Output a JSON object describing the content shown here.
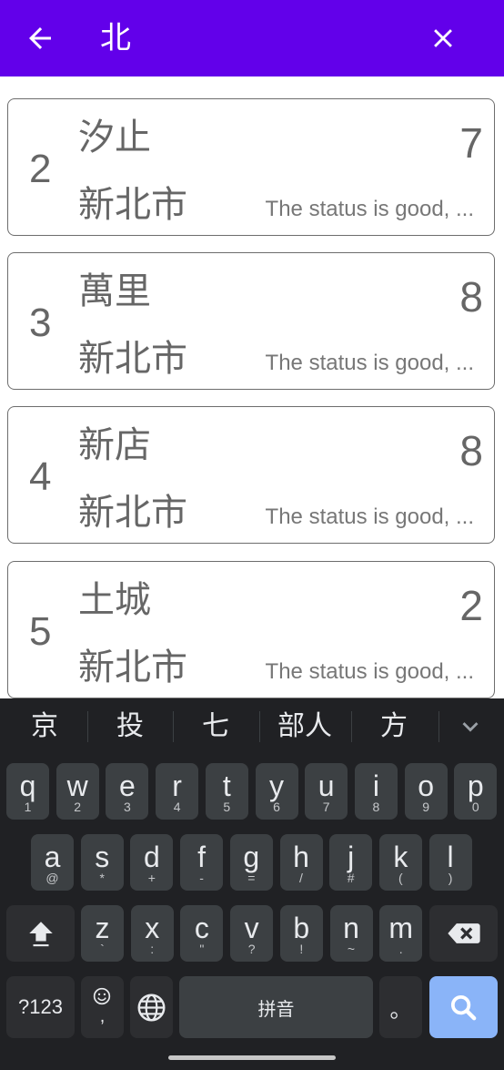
{
  "search": {
    "query": "北"
  },
  "results": [
    {
      "rank": "2",
      "name": "汐止",
      "city": "新北市",
      "count": "7",
      "status": "The status is good, ..."
    },
    {
      "rank": "3",
      "name": "萬里",
      "city": "新北市",
      "count": "8",
      "status": "The status is good, ..."
    },
    {
      "rank": "4",
      "name": "新店",
      "city": "新北市",
      "count": "8",
      "status": "The status is good, ..."
    },
    {
      "rank": "5",
      "name": "土城",
      "city": "新北市",
      "count": "2",
      "status": "The status is good, ..."
    }
  ],
  "keyboard": {
    "suggestions": [
      "京",
      "投",
      "七",
      "部人",
      "方"
    ],
    "row1": [
      {
        "key": "q",
        "sub": "1"
      },
      {
        "key": "w",
        "sub": "2"
      },
      {
        "key": "e",
        "sub": "3"
      },
      {
        "key": "r",
        "sub": "4"
      },
      {
        "key": "t",
        "sub": "5"
      },
      {
        "key": "y",
        "sub": "6"
      },
      {
        "key": "u",
        "sub": "7"
      },
      {
        "key": "i",
        "sub": "8"
      },
      {
        "key": "o",
        "sub": "9"
      },
      {
        "key": "p",
        "sub": "0"
      }
    ],
    "row2": [
      {
        "key": "a",
        "sub": "@"
      },
      {
        "key": "s",
        "sub": "*"
      },
      {
        "key": "d",
        "sub": "+"
      },
      {
        "key": "f",
        "sub": "-"
      },
      {
        "key": "g",
        "sub": "="
      },
      {
        "key": "h",
        "sub": "/"
      },
      {
        "key": "j",
        "sub": "#"
      },
      {
        "key": "k",
        "sub": "("
      },
      {
        "key": "l",
        "sub": ")"
      }
    ],
    "row3": [
      {
        "key": "z",
        "sub": "`"
      },
      {
        "key": "x",
        "sub": ":"
      },
      {
        "key": "c",
        "sub": "\""
      },
      {
        "key": "v",
        "sub": "?"
      },
      {
        "key": "b",
        "sub": "!"
      },
      {
        "key": "n",
        "sub": "~"
      },
      {
        "key": "m",
        "sub": "."
      }
    ],
    "symbols_label": "?123",
    "emoji_sub": ",",
    "space_label": "拼音",
    "period_label": "。"
  },
  "colors": {
    "appbar": "#6200ea",
    "keyboard_bg": "#202124",
    "key_bg": "#3c4043",
    "search_key": "#8ab4f8"
  }
}
